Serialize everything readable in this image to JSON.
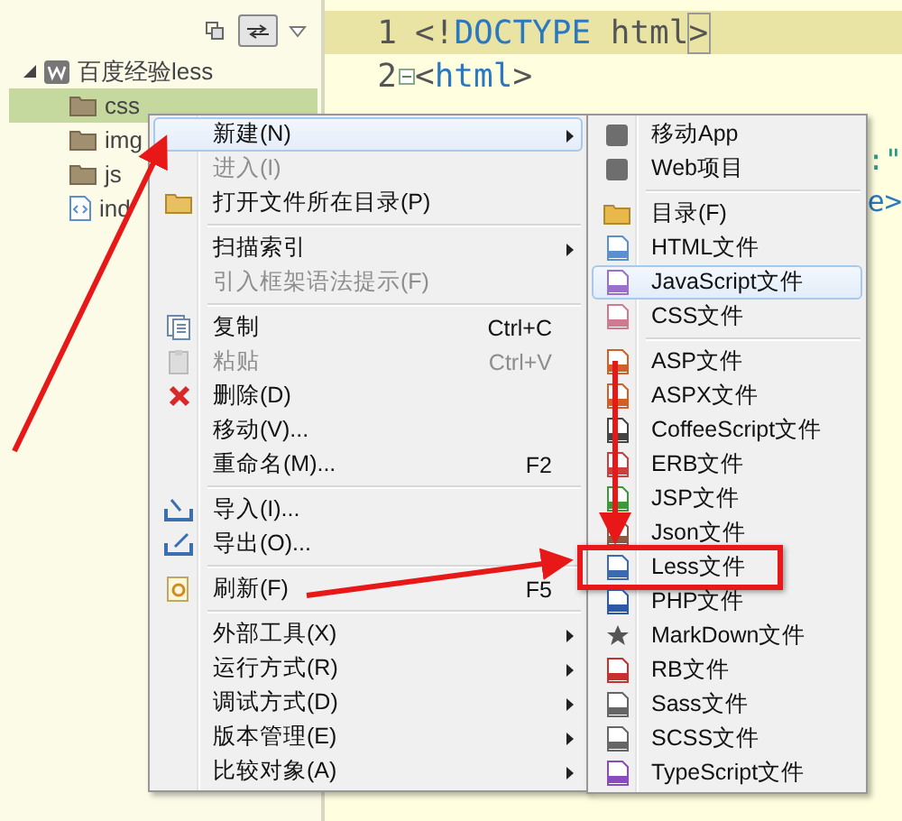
{
  "explorer": {
    "tree": [
      {
        "label": "百度经验less",
        "expanded": true,
        "selected": false,
        "children": [
          {
            "label": "css",
            "kind": "folder",
            "selected": true
          },
          {
            "label": "img",
            "kind": "folder",
            "selected": false
          },
          {
            "label": "js",
            "kind": "folder",
            "selected": false
          },
          {
            "label": "ind",
            "kind": "file",
            "selected": false
          }
        ]
      }
    ]
  },
  "editor": {
    "lines": [
      {
        "number": "1",
        "highlighted": true,
        "foldable": false,
        "tokens": [
          {
            "text": "<!",
            "kind": "punct",
            "matched": false
          },
          {
            "text": "DOCTYPE",
            "kind": "keyword",
            "matched": false
          },
          {
            "text": " html",
            "kind": "plain",
            "matched": false
          },
          {
            "text": ">",
            "kind": "punct",
            "matched": true
          }
        ]
      },
      {
        "number": "2",
        "highlighted": false,
        "foldable": true,
        "tokens": [
          {
            "text": "<",
            "kind": "punct",
            "matched": false
          },
          {
            "text": "html",
            "kind": "keyword",
            "matched": false
          },
          {
            "text": ">",
            "kind": "punct",
            "matched": false
          }
        ]
      }
    ],
    "partial_lines": [
      {
        "text": ":\"",
        "kind": "string"
      },
      {
        "text": "e>",
        "kind": "keyword"
      }
    ]
  },
  "context_menu": {
    "groups": [
      [
        {
          "label": "新建(N)",
          "selected": true,
          "disabled": false,
          "submenu": true
        },
        {
          "label": "进入(I)",
          "selected": false,
          "disabled": true,
          "submenu": false
        },
        {
          "label": "打开文件所在目录(P)",
          "selected": false,
          "disabled": false,
          "submenu": false,
          "kind": "folder"
        }
      ],
      [
        {
          "label": "扫描索引",
          "selected": false,
          "disabled": false,
          "submenu": true
        },
        {
          "label": "引入框架语法提示(F)",
          "selected": false,
          "disabled": true,
          "submenu": false
        }
      ],
      [
        {
          "label": "复制",
          "shortcut": "Ctrl+C",
          "selected": false,
          "disabled": false,
          "submenu": false,
          "kind": "copy"
        },
        {
          "label": "粘贴",
          "shortcut": "Ctrl+V",
          "selected": false,
          "disabled": true,
          "submenu": false,
          "kind": "paste"
        },
        {
          "label": "删除(D)",
          "selected": false,
          "disabled": false,
          "submenu": false,
          "kind": "delete"
        },
        {
          "label": "移动(V)...",
          "selected": false,
          "disabled": false,
          "submenu": false
        },
        {
          "label": "重命名(M)...",
          "shortcut": "F2",
          "selected": false,
          "disabled": false,
          "submenu": false
        }
      ],
      [
        {
          "label": "导入(I)...",
          "selected": false,
          "disabled": false,
          "submenu": false,
          "kind": "import"
        },
        {
          "label": "导出(O)...",
          "selected": false,
          "disabled": false,
          "submenu": false,
          "kind": "export"
        }
      ],
      [
        {
          "label": "刷新(F)",
          "shortcut": "F5",
          "selected": false,
          "disabled": false,
          "submenu": false,
          "kind": "refresh"
        }
      ],
      [
        {
          "label": "外部工具(X)",
          "selected": false,
          "disabled": false,
          "submenu": true
        },
        {
          "label": "运行方式(R)",
          "selected": false,
          "disabled": false,
          "submenu": true
        },
        {
          "label": "调试方式(D)",
          "selected": false,
          "disabled": false,
          "submenu": true
        },
        {
          "label": "版本管理(E)",
          "selected": false,
          "disabled": false,
          "submenu": true
        },
        {
          "label": "比较对象(A)",
          "selected": false,
          "disabled": false,
          "submenu": true
        }
      ]
    ]
  },
  "submenu": {
    "groups": [
      [
        {
          "label": "移动App",
          "kind": "badge",
          "color": "#6e6e6e",
          "selected": false,
          "marked": false
        },
        {
          "label": "Web项目",
          "kind": "badge",
          "color": "#6e6e6e",
          "selected": false,
          "marked": false
        }
      ],
      [
        {
          "label": "目录(F)",
          "kind": "folder",
          "color": "#e8b84a",
          "selected": false,
          "marked": false
        },
        {
          "label": "HTML文件",
          "kind": "file",
          "color": "#5a8fd0",
          "selected": false,
          "marked": false
        },
        {
          "label": "JavaScript文件",
          "kind": "file",
          "color": "#9a6fd0",
          "selected": true,
          "marked": false
        },
        {
          "label": "CSS文件",
          "kind": "file",
          "color": "#d07a90",
          "selected": false,
          "marked": false
        }
      ],
      [
        {
          "label": "ASP文件",
          "kind": "file",
          "color": "#d0602a",
          "selected": false,
          "marked": false
        },
        {
          "label": "ASPX文件",
          "kind": "file",
          "color": "#d0602a",
          "selected": false,
          "marked": false
        },
        {
          "label": "CoffeeScript文件",
          "kind": "file",
          "color": "#444444",
          "selected": false,
          "marked": false
        },
        {
          "label": "ERB文件",
          "kind": "file",
          "color": "#c84040",
          "selected": false,
          "marked": false
        },
        {
          "label": "JSP文件",
          "kind": "file",
          "color": "#3a9a3a",
          "selected": false,
          "marked": false
        },
        {
          "label": "Json文件",
          "kind": "file",
          "color": "#8a5a40",
          "selected": false,
          "marked": false
        },
        {
          "label": "Less文件",
          "kind": "file",
          "color": "#3a6ab0",
          "selected": false,
          "marked": true
        },
        {
          "label": "PHP文件",
          "kind": "file",
          "color": "#2a5aa8",
          "selected": false,
          "marked": false
        },
        {
          "label": "MarkDown文件",
          "kind": "star",
          "color": "#555555",
          "selected": false,
          "marked": false
        },
        {
          "label": "RB文件",
          "kind": "file",
          "color": "#c83030",
          "selected": false,
          "marked": false
        },
        {
          "label": "Sass文件",
          "kind": "file",
          "color": "#666666",
          "selected": false,
          "marked": false
        },
        {
          "label": "SCSS文件",
          "kind": "file",
          "color": "#666666",
          "selected": false,
          "marked": false
        },
        {
          "label": "TypeScript文件",
          "kind": "file",
          "color": "#8a4ac0",
          "selected": false,
          "marked": false
        }
      ]
    ]
  }
}
